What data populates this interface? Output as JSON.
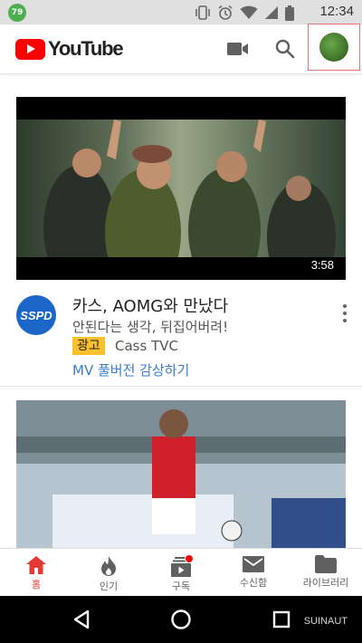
{
  "status_bar": {
    "badge": "79",
    "time": "12:34"
  },
  "app_bar": {
    "logo_text": "YouTube"
  },
  "video1": {
    "duration": "3:58"
  },
  "ad": {
    "title": "카스, AOMG와 만났다",
    "description": "안된다는 생각, 뒤집어버려!",
    "badge": "광고",
    "advertiser": "Cass TVC",
    "cta": "MV 풀버전 감상하기",
    "channel_logo_text": "SSPD"
  },
  "tabs": [
    {
      "label": "홈",
      "icon": "home-icon"
    },
    {
      "label": "인기",
      "icon": "trending-icon"
    },
    {
      "label": "구독",
      "icon": "subscriptions-icon"
    },
    {
      "label": "수신함",
      "icon": "inbox-icon"
    },
    {
      "label": "라이브러리",
      "icon": "library-icon"
    }
  ],
  "colors": {
    "brand_red": "#ff0000",
    "active_tab": "#e53935",
    "ad_badge": "#fbc02d",
    "link_blue": "#3a7dd0"
  },
  "watermark": "SUINAUT"
}
